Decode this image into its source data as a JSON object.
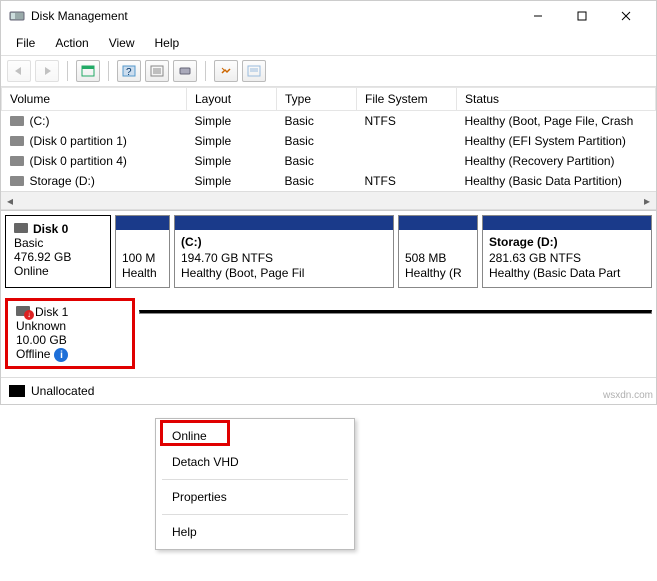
{
  "window": {
    "title": "Disk Management"
  },
  "menu": {
    "file": "File",
    "action": "Action",
    "view": "View",
    "help": "Help"
  },
  "columns": {
    "volume": "Volume",
    "layout": "Layout",
    "type": "Type",
    "filesystem": "File System",
    "status": "Status"
  },
  "volumes": [
    {
      "name": "(C:)",
      "layout": "Simple",
      "type": "Basic",
      "fs": "NTFS",
      "status": "Healthy (Boot, Page File, Crash"
    },
    {
      "name": "(Disk 0 partition 1)",
      "layout": "Simple",
      "type": "Basic",
      "fs": "",
      "status": "Healthy (EFI System Partition)"
    },
    {
      "name": "(Disk 0 partition 4)",
      "layout": "Simple",
      "type": "Basic",
      "fs": "",
      "status": "Healthy (Recovery Partition)"
    },
    {
      "name": "Storage (D:)",
      "layout": "Simple",
      "type": "Basic",
      "fs": "NTFS",
      "status": "Healthy (Basic Data Partition)"
    }
  ],
  "disk0": {
    "name": "Disk 0",
    "type": "Basic",
    "size": "476.92 GB",
    "state": "Online",
    "parts": [
      {
        "title": "",
        "size": "100 M",
        "status": "Health"
      },
      {
        "title": "(C:)",
        "size": "194.70 GB NTFS",
        "status": "Healthy (Boot, Page Fil"
      },
      {
        "title": "",
        "size": "508 MB",
        "status": "Healthy (R"
      },
      {
        "title": "Storage  (D:)",
        "size": "281.63 GB NTFS",
        "status": "Healthy (Basic Data Part"
      }
    ]
  },
  "disk1": {
    "name": "Disk 1",
    "type": "Unknown",
    "size": "10.00 GB",
    "state": "Offline"
  },
  "context_menu": {
    "online": "Online",
    "detach": "Detach VHD",
    "properties": "Properties",
    "help": "Help"
  },
  "legend": {
    "unallocated": "Unallocated"
  },
  "watermark": "wsxdn.com"
}
